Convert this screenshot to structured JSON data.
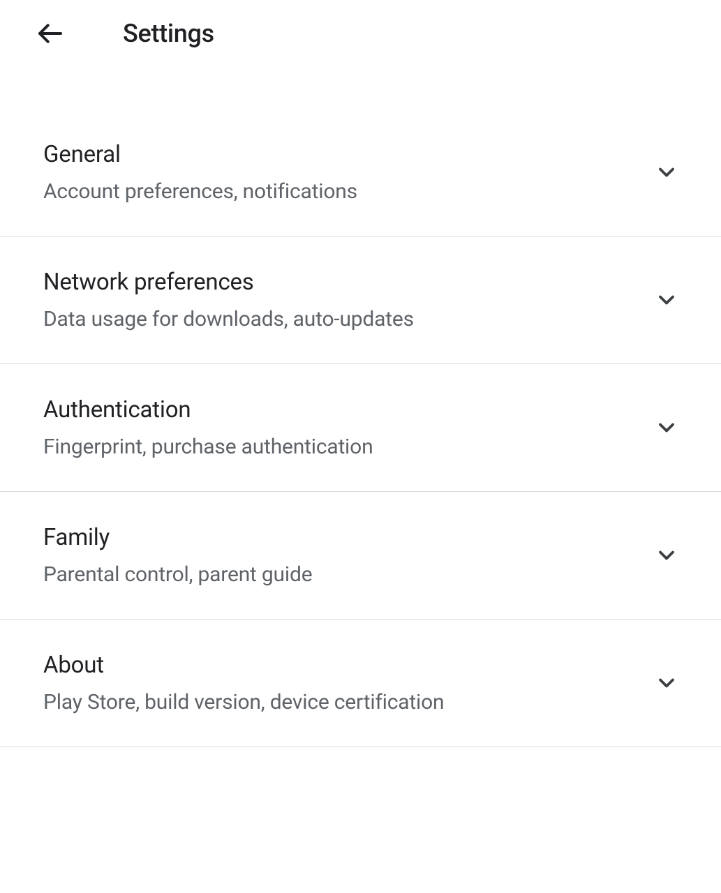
{
  "header": {
    "title": "Settings"
  },
  "settings": {
    "items": [
      {
        "title": "General",
        "subtitle": "Account preferences, notifications"
      },
      {
        "title": "Network preferences",
        "subtitle": "Data usage for downloads, auto-updates"
      },
      {
        "title": "Authentication",
        "subtitle": "Fingerprint, purchase authentication"
      },
      {
        "title": "Family",
        "subtitle": "Parental control, parent guide"
      },
      {
        "title": "About",
        "subtitle": "Play Store, build version, device certification"
      }
    ]
  }
}
